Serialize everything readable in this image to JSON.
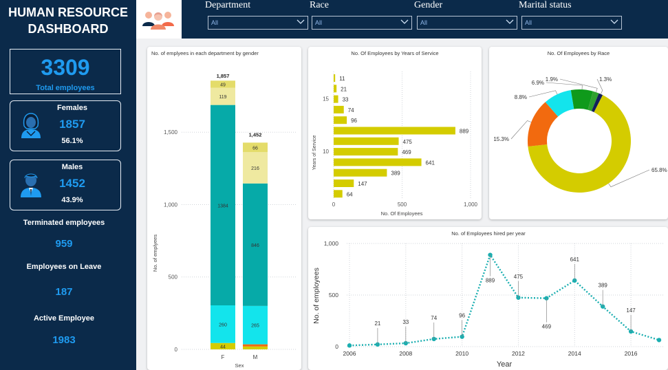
{
  "dashboard": {
    "title_line1": "HUMAN RESOURCE",
    "title_line2": "DASHBOARD"
  },
  "kpis": {
    "total_value": "3309",
    "total_label": "Total employees",
    "females_label": "Females",
    "females_value": "1857",
    "females_pct": "56.1%",
    "males_label": "Males",
    "males_value": "1452",
    "males_pct": "43.9%",
    "terminated_label": "Terminated employees",
    "terminated_value": "959",
    "leave_label": "Employees on Leave",
    "leave_value": "187",
    "active_label": "Active Employee",
    "active_value": "1983"
  },
  "filters": [
    {
      "label": "Department",
      "value": "All"
    },
    {
      "label": "Race",
      "value": "All"
    },
    {
      "label": "Gender",
      "value": "All"
    },
    {
      "label": "Marital status",
      "value": "All"
    }
  ],
  "icons": {
    "team": "team-people-icon",
    "female": "female-avatar-icon",
    "male": "male-avatar-icon",
    "dropdown": "chevron-down-icon"
  },
  "colors": {
    "sidebar_bg": "#0b2a4a",
    "accent_blue": "#1f9bf0",
    "olive": "#d4cc00",
    "teal": "#06aaa8",
    "cyan": "#13e4ec",
    "pale_yellow": "#efe9a0",
    "orange": "#f26a0f",
    "green": "#0f9a1b",
    "navy": "#14205a",
    "line_teal": "#1aaeb0"
  },
  "chart_data": [
    {
      "type": "bar",
      "stacked": true,
      "title": "No. of emplyees in each department by gender",
      "xlabel": "Sex",
      "ylabel": "No. of emplyees",
      "categories": [
        "F",
        "M"
      ],
      "ylim": [
        0,
        1900
      ],
      "yticks": [
        0,
        500,
        1000,
        1500
      ],
      "ytick_labels": [
        "0",
        "500",
        "1,000",
        "1,500"
      ],
      "totals": [
        1857,
        1452
      ],
      "total_labels": [
        "1,857",
        "1,452"
      ],
      "series": [
        {
          "values": [
            44,
            20
          ],
          "color": "#d4cc00",
          "labels": [
            "44",
            ""
          ]
        },
        {
          "values": [
            0,
            15
          ],
          "color": "#f26a0f",
          "labels": [
            "",
            ""
          ]
        },
        {
          "values": [
            260,
            265
          ],
          "color": "#13e4ec",
          "labels": [
            "260",
            "265"
          ]
        },
        {
          "values": [
            1384,
            846
          ],
          "color": "#06aaa8",
          "labels": [
            "1384",
            "846"
          ]
        },
        {
          "values": [
            119,
            216
          ],
          "color": "#efe9a0",
          "labels": [
            "119",
            "216"
          ]
        },
        {
          "values": [
            49,
            66
          ],
          "color": "#e4dc6a",
          "labels": [
            "49",
            "66"
          ]
        }
      ],
      "grid": true
    },
    {
      "type": "bar",
      "orientation": "horizontal",
      "title": "No. Of Employees by Years of Service",
      "xlabel": "No. Of Employees",
      "ylabel": "Years of Service",
      "values": [
        11,
        21,
        33,
        74,
        96,
        889,
        475,
        469,
        641,
        389,
        147,
        64
      ],
      "value_labels": [
        "11",
        "21",
        "33",
        "74",
        "96",
        "889",
        "475",
        "469",
        "641",
        "389",
        "147",
        "64"
      ],
      "ytick_labels": [
        "15",
        "10"
      ],
      "xlim": [
        0,
        1000
      ],
      "xticks": [
        "0",
        "500",
        "1,000"
      ],
      "color": "#d4cc00",
      "grid": true
    },
    {
      "type": "pie",
      "donut": true,
      "title": "No. Of Employees by Race",
      "values": [
        65.8,
        15.3,
        8.8,
        6.9,
        1.9,
        1.3
      ],
      "labels": [
        "65.8%",
        "15.3%",
        "8.8%",
        "6.9%",
        "1.9%",
        "1.3%"
      ],
      "colors": [
        "#d4cc00",
        "#f26a0f",
        "#13e4ec",
        "#0f9a1b",
        "#2fa12f",
        "#14205a"
      ]
    },
    {
      "type": "line",
      "title": "No. of Employees hired per year",
      "xlabel": "Year",
      "ylabel": "No. of employees",
      "x": [
        2006,
        2007,
        2008,
        2009,
        2010,
        2011,
        2012,
        2013,
        2014,
        2015,
        2016,
        2017
      ],
      "values": [
        11,
        21,
        33,
        74,
        96,
        889,
        475,
        469,
        641,
        389,
        147,
        64
      ],
      "point_labels": [
        "",
        "21",
        "33",
        "74",
        "96",
        "889",
        "475",
        "469",
        "641",
        "389",
        "147",
        ""
      ],
      "xticks": [
        "2006",
        "2008",
        "2010",
        "2012",
        "2014",
        "2016"
      ],
      "ylim": [
        0,
        1000
      ],
      "yticks": [
        "0",
        "500",
        "1,000"
      ],
      "color": "#1aaeb0",
      "grid": true
    }
  ]
}
